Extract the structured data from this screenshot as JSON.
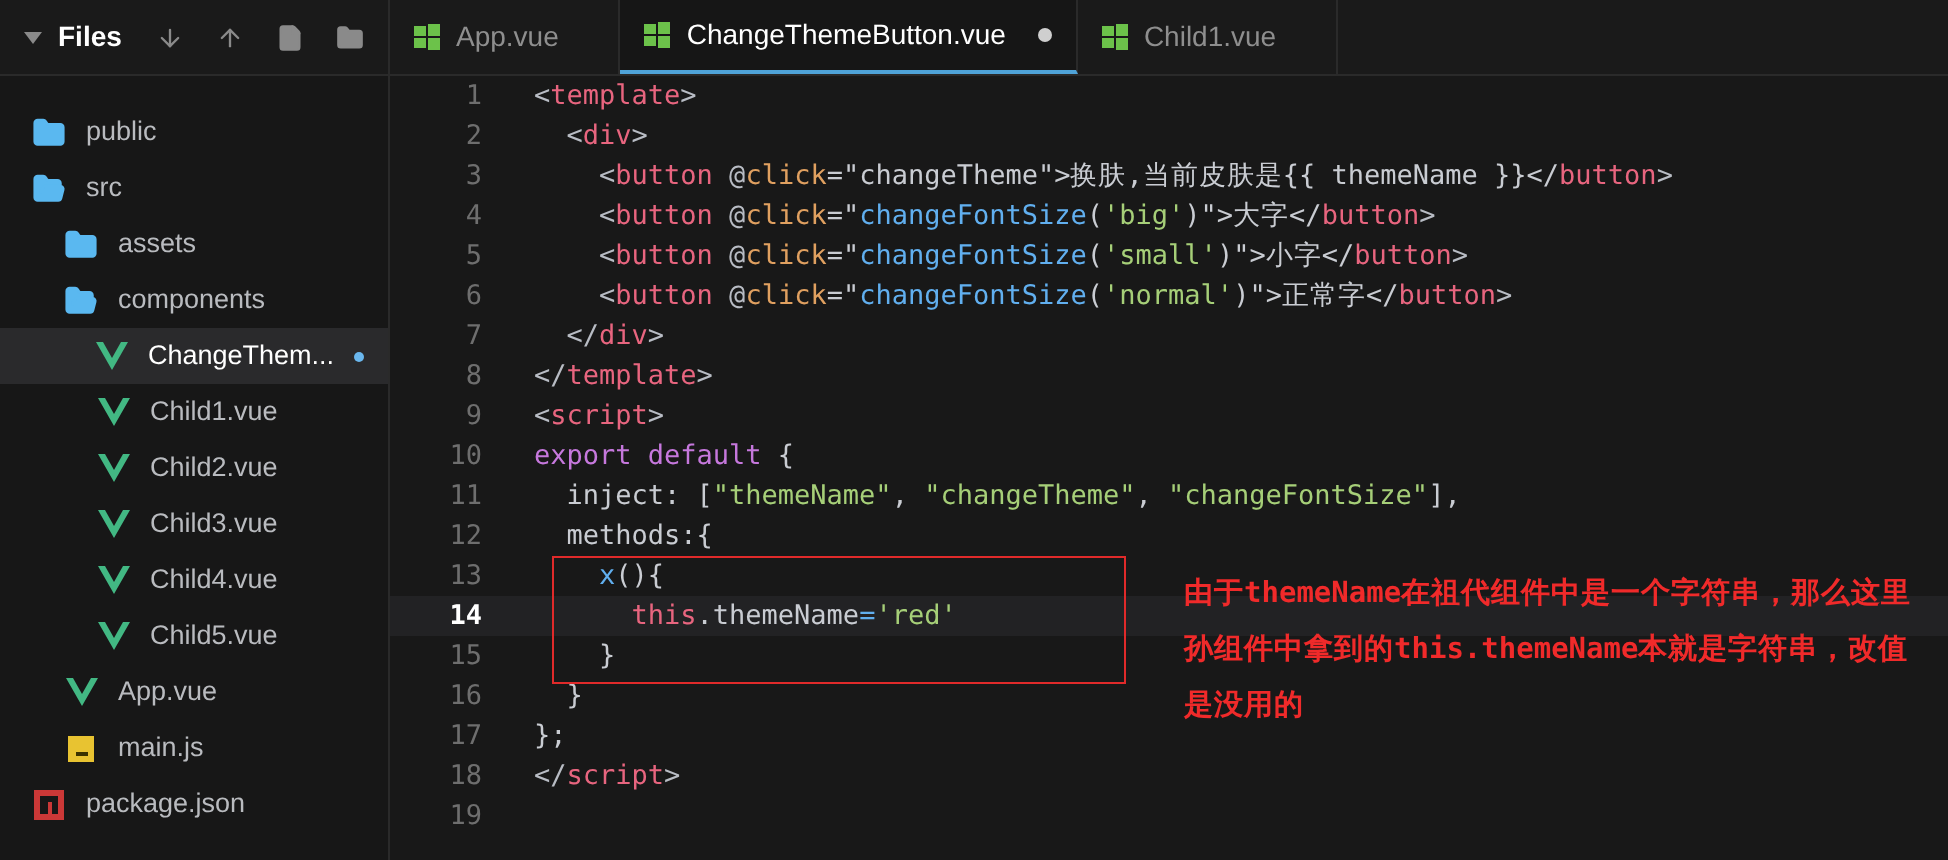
{
  "sidebar": {
    "title": "Files",
    "expanded": true,
    "tree": [
      {
        "name": "public",
        "kind": "folder",
        "expanded": false,
        "selected": false,
        "modified": false
      },
      {
        "name": "src",
        "kind": "folder",
        "expanded": true,
        "selected": false,
        "modified": false,
        "children": [
          {
            "name": "assets",
            "kind": "folder",
            "expanded": false,
            "selected": false,
            "modified": false
          },
          {
            "name": "components",
            "kind": "folder",
            "expanded": true,
            "selected": false,
            "modified": false,
            "children": [
              {
                "name": "ChangeThem...",
                "kind": "vue",
                "selected": true,
                "modified": true
              },
              {
                "name": "Child1.vue",
                "kind": "vue",
                "selected": false,
                "modified": false
              },
              {
                "name": "Child2.vue",
                "kind": "vue",
                "selected": false,
                "modified": false
              },
              {
                "name": "Child3.vue",
                "kind": "vue",
                "selected": false,
                "modified": false
              },
              {
                "name": "Child4.vue",
                "kind": "vue",
                "selected": false,
                "modified": false
              },
              {
                "name": "Child5.vue",
                "kind": "vue",
                "selected": false,
                "modified": false
              }
            ]
          },
          {
            "name": "App.vue",
            "kind": "vue",
            "selected": false,
            "modified": false
          },
          {
            "name": "main.js",
            "kind": "js",
            "selected": false,
            "modified": false
          }
        ]
      },
      {
        "name": "package.json",
        "kind": "npm",
        "selected": false,
        "modified": false
      }
    ]
  },
  "tabs": [
    {
      "label": "App.vue",
      "selected": false,
      "modified": false
    },
    {
      "label": "ChangeThemeButton.vue",
      "selected": true,
      "modified": true
    },
    {
      "label": "Child1.vue",
      "selected": false,
      "modified": false
    }
  ],
  "editor": {
    "lines": [
      {
        "number": "1",
        "current": false,
        "tokens": [
          {
            "t": "<",
            "kind": "punct"
          },
          {
            "t": "template",
            "kind": "tag"
          },
          {
            "t": ">",
            "kind": "punct"
          }
        ]
      },
      {
        "number": "2",
        "current": false,
        "tokens": [
          {
            "t": "  <",
            "kind": "punct"
          },
          {
            "t": "div",
            "kind": "tag"
          },
          {
            "t": ">",
            "kind": "punct"
          }
        ]
      },
      {
        "number": "3",
        "current": false,
        "tokens": [
          {
            "t": "    <",
            "kind": "punct"
          },
          {
            "t": "button",
            "kind": "tag"
          },
          {
            "t": " @",
            "kind": "punct"
          },
          {
            "t": "click",
            "kind": "attr"
          },
          {
            "t": "=\"changeTheme\">换肤,当前皮肤是{{ themeName }}</",
            "kind": "plain"
          },
          {
            "t": "button",
            "kind": "tag"
          },
          {
            "t": ">",
            "kind": "punct"
          }
        ]
      },
      {
        "number": "4",
        "current": false,
        "tokens": [
          {
            "t": "    <",
            "kind": "punct"
          },
          {
            "t": "button",
            "kind": "tag"
          },
          {
            "t": " @",
            "kind": "punct"
          },
          {
            "t": "click",
            "kind": "attr"
          },
          {
            "t": "=\"",
            "kind": "plain"
          },
          {
            "t": "changeFontSize",
            "kind": "func"
          },
          {
            "t": "(",
            "kind": "plain"
          },
          {
            "t": "'big'",
            "kind": "string"
          },
          {
            "t": ")\">大字</",
            "kind": "plain"
          },
          {
            "t": "button",
            "kind": "tag"
          },
          {
            "t": ">",
            "kind": "punct"
          }
        ]
      },
      {
        "number": "5",
        "current": false,
        "tokens": [
          {
            "t": "    <",
            "kind": "punct"
          },
          {
            "t": "button",
            "kind": "tag"
          },
          {
            "t": " @",
            "kind": "punct"
          },
          {
            "t": "click",
            "kind": "attr"
          },
          {
            "t": "=\"",
            "kind": "plain"
          },
          {
            "t": "changeFontSize",
            "kind": "func"
          },
          {
            "t": "(",
            "kind": "plain"
          },
          {
            "t": "'small'",
            "kind": "string"
          },
          {
            "t": ")\">小字</",
            "kind": "plain"
          },
          {
            "t": "button",
            "kind": "tag"
          },
          {
            "t": ">",
            "kind": "punct"
          }
        ]
      },
      {
        "number": "6",
        "current": false,
        "tokens": [
          {
            "t": "    <",
            "kind": "punct"
          },
          {
            "t": "button",
            "kind": "tag"
          },
          {
            "t": " @",
            "kind": "punct"
          },
          {
            "t": "click",
            "kind": "attr"
          },
          {
            "t": "=\"",
            "kind": "plain"
          },
          {
            "t": "changeFontSize",
            "kind": "func"
          },
          {
            "t": "(",
            "kind": "plain"
          },
          {
            "t": "'normal'",
            "kind": "string"
          },
          {
            "t": ")\">正常字</",
            "kind": "plain"
          },
          {
            "t": "button",
            "kind": "tag"
          },
          {
            "t": ">",
            "kind": "punct"
          }
        ]
      },
      {
        "number": "7",
        "current": false,
        "tokens": [
          {
            "t": "  </",
            "kind": "punct"
          },
          {
            "t": "div",
            "kind": "tag"
          },
          {
            "t": ">",
            "kind": "punct"
          }
        ]
      },
      {
        "number": "8",
        "current": false,
        "tokens": [
          {
            "t": "</",
            "kind": "punct"
          },
          {
            "t": "template",
            "kind": "tag"
          },
          {
            "t": ">",
            "kind": "punct"
          }
        ]
      },
      {
        "number": "9",
        "current": false,
        "tokens": [
          {
            "t": "<",
            "kind": "punct"
          },
          {
            "t": "script",
            "kind": "tag"
          },
          {
            "t": ">",
            "kind": "punct"
          }
        ]
      },
      {
        "number": "10",
        "current": false,
        "tokens": [
          {
            "t": "export default",
            "kind": "keyword"
          },
          {
            "t": " {",
            "kind": "plain"
          }
        ]
      },
      {
        "number": "11",
        "current": false,
        "tokens": [
          {
            "t": "  inject: [",
            "kind": "plain"
          },
          {
            "t": "\"themeName\"",
            "kind": "string"
          },
          {
            "t": ", ",
            "kind": "plain"
          },
          {
            "t": "\"changeTheme\"",
            "kind": "string"
          },
          {
            "t": ", ",
            "kind": "plain"
          },
          {
            "t": "\"changeFontSize\"",
            "kind": "string"
          },
          {
            "t": "],",
            "kind": "plain"
          }
        ]
      },
      {
        "number": "12",
        "current": false,
        "tokens": [
          {
            "t": "  methods:{",
            "kind": "plain"
          }
        ]
      },
      {
        "number": "13",
        "current": false,
        "tokens": [
          {
            "t": "    x",
            "kind": "func"
          },
          {
            "t": "(){",
            "kind": "plain"
          }
        ]
      },
      {
        "number": "14",
        "current": true,
        "tokens": [
          {
            "t": "      this",
            "kind": "this"
          },
          {
            "t": ".themeName",
            "kind": "plain"
          },
          {
            "t": "=",
            "kind": "func"
          },
          {
            "t": "'red'",
            "kind": "string"
          }
        ]
      },
      {
        "number": "15",
        "current": false,
        "tokens": [
          {
            "t": "    }",
            "kind": "plain"
          }
        ]
      },
      {
        "number": "16",
        "current": false,
        "tokens": [
          {
            "t": "  }",
            "kind": "plain"
          }
        ]
      },
      {
        "number": "17",
        "current": false,
        "tokens": [
          {
            "t": "};",
            "kind": "plain"
          }
        ]
      },
      {
        "number": "18",
        "current": false,
        "tokens": [
          {
            "t": "</",
            "kind": "punct"
          },
          {
            "t": "script",
            "kind": "tag"
          },
          {
            "t": ">",
            "kind": "punct"
          }
        ]
      },
      {
        "number": "19",
        "current": false
      }
    ]
  },
  "annotation": {
    "text": "由于themeName在祖代组件中是一个字符串，那么这里孙组件中拿到的this.themeName本就是字符串，改值是没用的"
  }
}
